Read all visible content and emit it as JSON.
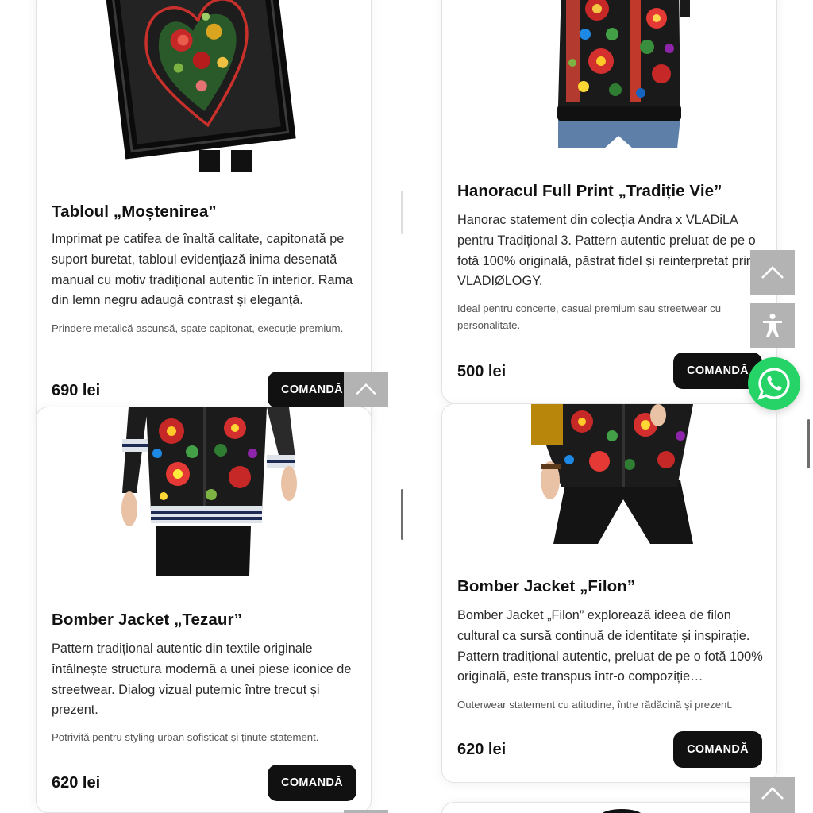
{
  "products": [
    {
      "title": "Tabloul „Moștenirea”",
      "description": "Imprimat pe catifea de înaltă calitate, capitonată pe suport buretat, tabloul evidențiază inima desenată manual cu motiv tradițional autentic în interior. Rama din lemn negru adaugă contrast și eleganță.",
      "note": "Prindere metalică ascunsă, spate capitonat, execuție premium.",
      "price": "690 lei",
      "button": "COMANDĂ"
    },
    {
      "title": "Hanoracul Full Print „Tradiție Vie”",
      "description": "Hanorac statement din colecția Andra x VLADiLA pentru Tradițional 3. Pattern autentic preluat de pe o fotă 100% originală, păstrat fidel și reinterpretat prin VLADIØLOGY.",
      "note": "Ideal pentru concerte, casual premium sau streetwear cu personalitate.",
      "price": "500 lei",
      "button": "COMANDĂ"
    },
    {
      "title": "Bomber Jacket „Tezaur”",
      "description": "Pattern tradițional autentic din textile originale întâlnește structura modernă a unei piese iconice de streetwear. Dialog vizual puternic între trecut și prezent.",
      "note": "Potrivită pentru styling urban sofisticat și ținute statement.",
      "price": "620 lei",
      "button": "COMANDĂ"
    },
    {
      "title": "Bomber Jacket „Filon”",
      "description": "Bomber Jacket „Filon” explorează ideea de filon cultural ca sursă continuă de identitate și inspirație. Pattern tradițional autentic, preluat de pe o fotă 100% originală, este transpus într-o compoziție…",
      "note": "Outerwear statement cu atitudine, între rădăcină și prezent.",
      "price": "620 lei",
      "button": "COMANDĂ"
    }
  ],
  "icons": {
    "scroll_top": "chevron-up-icon",
    "accessibility": "accessibility-icon",
    "whatsapp": "whatsapp-icon"
  },
  "colors": {
    "button_bg": "#111111",
    "side_button_bg": "#b3b3b3",
    "whatsapp_green": "#25d366"
  }
}
